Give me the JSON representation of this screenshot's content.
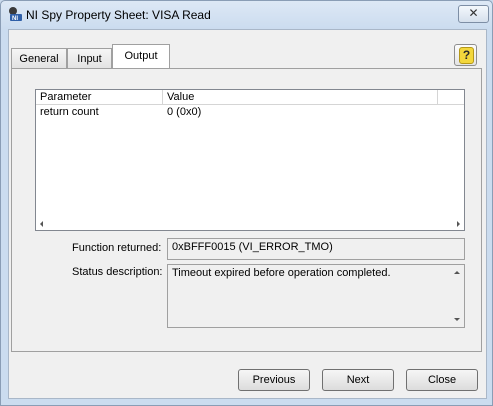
{
  "window": {
    "title": "NI Spy Property Sheet: VISA Read",
    "close_glyph": "✕",
    "icon": "ni-spy-icon"
  },
  "tabs": [
    {
      "label": "General",
      "active": false
    },
    {
      "label": "Input",
      "active": false
    },
    {
      "label": "Output",
      "active": true
    }
  ],
  "help_glyph": "?",
  "table": {
    "columns": [
      "Parameter",
      "Value"
    ],
    "rows": [
      {
        "parameter": "return count",
        "value": "0 (0x0)"
      }
    ]
  },
  "function_returned": {
    "label": "Function returned:",
    "value": "0xBFFF0015 (VI_ERROR_TMO)"
  },
  "status_description": {
    "label": "Status description:",
    "value": "Timeout expired before operation completed."
  },
  "buttons": {
    "previous": "Previous",
    "next": "Next",
    "close": "Close"
  },
  "colors": {
    "help_icon": "#f3d73c",
    "title_bar": "#dde8f5"
  }
}
